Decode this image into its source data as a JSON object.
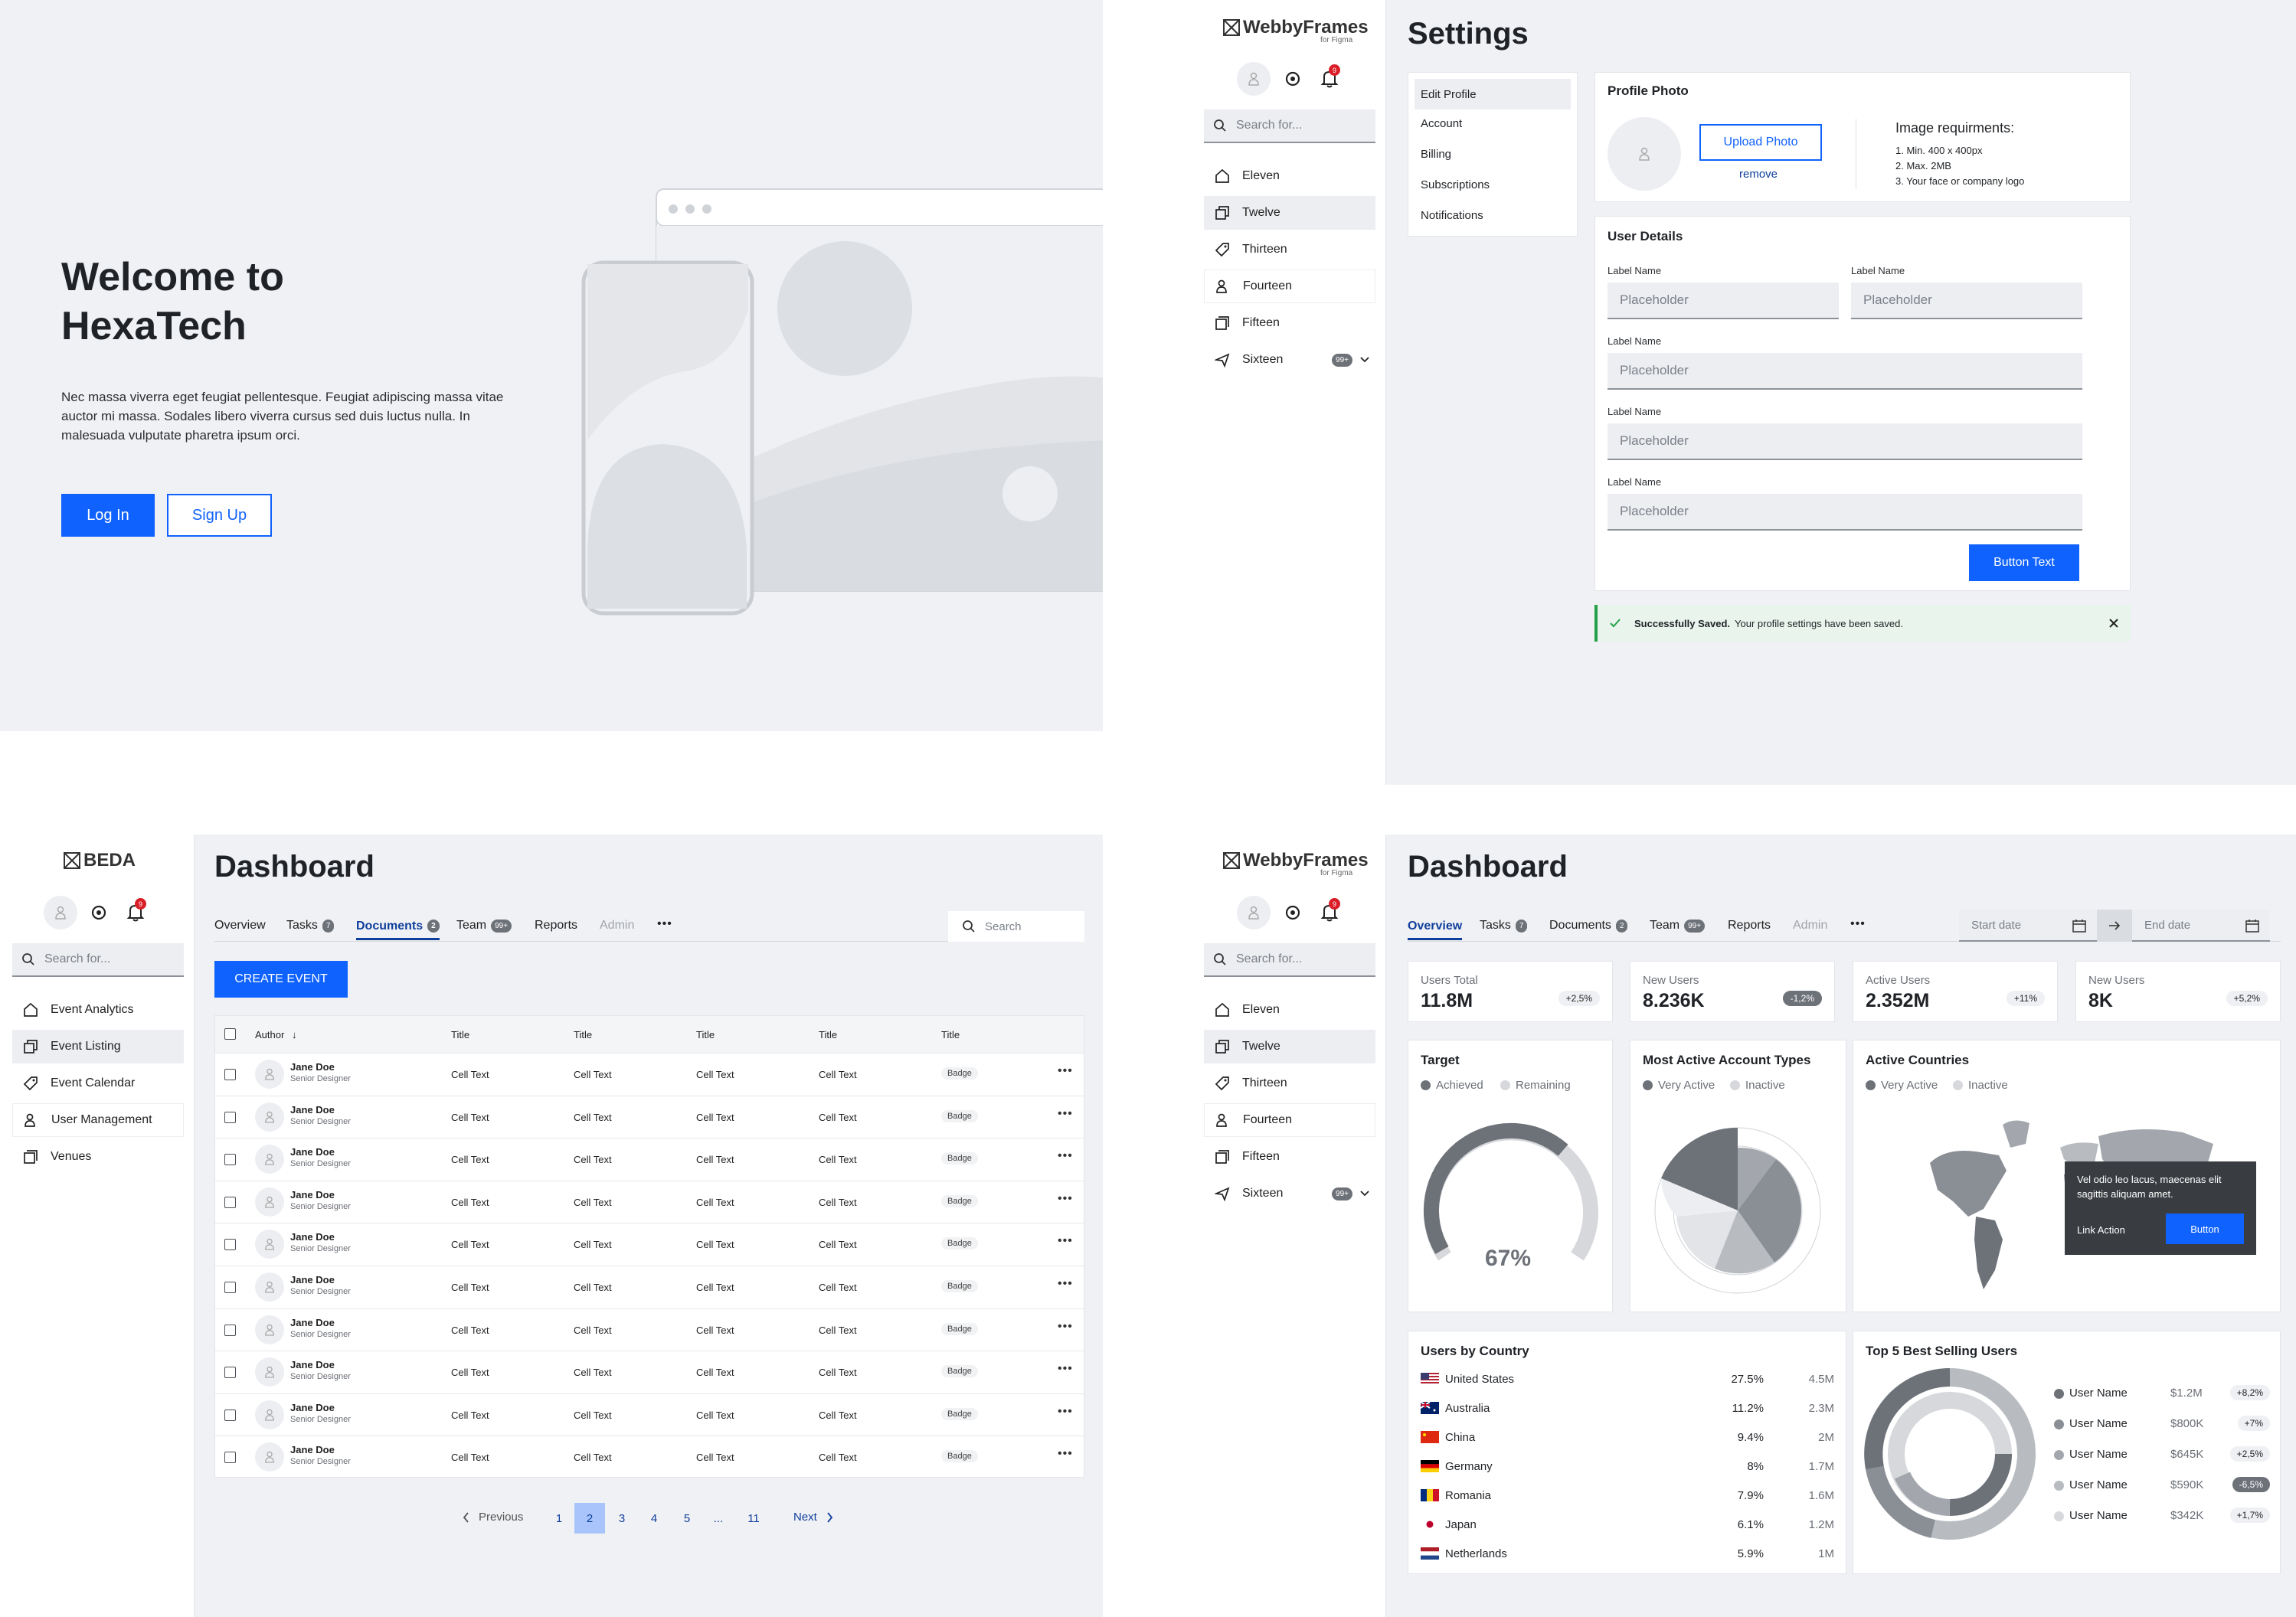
{
  "welcome": {
    "title_line1": "Welcome to",
    "title_line2": "HexaTech",
    "body": "Nec massa viverra eget feugiat pellentesque. Feugiat adipiscing massa vitae auctor mi massa. Sodales libero viverra cursus sed duis luctus nulla. In malesuada vulputate pharetra ipsum orci.",
    "login": "Log In",
    "signup": "Sign Up"
  },
  "brand": {
    "name": "WebbyFrames",
    "sub": "for Figma",
    "beda": "BEDA",
    "notif_count": "9",
    "accent": "#0f62fe"
  },
  "search": {
    "placeholder": "Search for..."
  },
  "nav": {
    "items": [
      {
        "label": "Eleven",
        "icon": "home-icon"
      },
      {
        "label": "Twelve",
        "icon": "copy-icon"
      },
      {
        "label": "Thirteen",
        "icon": "tag-icon"
      },
      {
        "label": "Fourteen",
        "icon": "users-icon"
      },
      {
        "label": "Fifteen",
        "icon": "gallery-icon"
      },
      {
        "label": "Sixteen",
        "icon": "plane-icon",
        "badge": "99+"
      }
    ]
  },
  "beda_nav": {
    "items": [
      "Event Analytics",
      "Event Listing",
      "Event Calendar",
      "User Management",
      "Venues"
    ]
  },
  "settings": {
    "title": "Settings",
    "menu": [
      "Edit Profile",
      "Account",
      "Billing",
      "Subscriptions",
      "Notifications"
    ],
    "photo": {
      "title": "Profile Photo",
      "upload": "Upload Photo",
      "remove": "remove",
      "req_title": "Image requirments:",
      "reqs": [
        "Min.  400 x 400px",
        "Max. 2MB",
        "Your face or company logo"
      ]
    },
    "details": {
      "title": "User Details",
      "label": "Label Name",
      "placeholder": "Placeholder",
      "button": "Button Text"
    },
    "toast": {
      "bold": "Successfully Saved.",
      "text": "Your profile settings have been saved."
    }
  },
  "dash1": {
    "title": "Dashboard",
    "tabs": [
      "Overview",
      "Tasks",
      "Documents",
      "Team",
      "Reports",
      "Admin"
    ],
    "tab_badges": {
      "tasks": "7",
      "documents": "2",
      "team": "99+"
    },
    "search": "Search",
    "create": "CREATE EVENT",
    "cols": [
      "Author",
      "Title",
      "Title",
      "Title",
      "Title",
      "Title"
    ],
    "rows": [
      {
        "name": "Jane Doe",
        "role": "Senior Designer",
        "cell": "Cell Text",
        "badge": "Badge"
      }
    ],
    "pager": {
      "prev": "Previous",
      "pages": [
        "1",
        "2",
        "3",
        "4",
        "5",
        "...",
        "11"
      ],
      "next": "Next",
      "current": "2"
    }
  },
  "dash2": {
    "title": "Dashboard",
    "tabs": [
      "Overview",
      "Tasks",
      "Documents",
      "Team",
      "Reports",
      "Admin"
    ],
    "start": "Start date",
    "end": "End date",
    "stats": [
      {
        "label": "Users Total",
        "value": "11.8M",
        "delta": "+2,5%"
      },
      {
        "label": "New Users",
        "value": "8.236K",
        "delta": "-1,2%"
      },
      {
        "label": "Active Users",
        "value": "2.352M",
        "delta": "+11%"
      },
      {
        "label": "New Users",
        "value": "8K",
        "delta": "+5,2%"
      }
    ],
    "target": {
      "title": "Target",
      "l1": "Achieved",
      "l2": "Remaining",
      "value": "67%",
      "fraction": 0.67
    },
    "types": {
      "title": "Most Active Account Types",
      "l1": "Very Active",
      "l2": "Inactive"
    },
    "countries_map": {
      "title": "Active Countries",
      "l1": "Very Active",
      "l2": "Inactive",
      "tooltip": "Vel odio leo lacus, maecenas elit sagittis aliquam amet.",
      "link": "Link Action",
      "button": "Button"
    },
    "by_country": {
      "title": "Users by Country",
      "rows": [
        {
          "name": "United States",
          "pct": "27.5%",
          "n": "4.5M"
        },
        {
          "name": "Australia",
          "pct": "11.2%",
          "n": "2.3M"
        },
        {
          "name": "China",
          "pct": "9.4%",
          "n": "2M"
        },
        {
          "name": "Germany",
          "pct": "8%",
          "n": "1.7M"
        },
        {
          "name": "Romania",
          "pct": "7.9%",
          "n": "1.6M"
        },
        {
          "name": "Japan",
          "pct": "6.1%",
          "n": "1.2M"
        },
        {
          "name": "Netherlands",
          "pct": "5.9%",
          "n": "1M"
        }
      ]
    },
    "top5": {
      "title": "Top 5 Best Selling Users",
      "rows": [
        {
          "name": "User Name",
          "amt": "$1.2M",
          "d": "+8,2%"
        },
        {
          "name": "User Name",
          "amt": "$800K",
          "d": "+7%"
        },
        {
          "name": "User Name",
          "amt": "$645K",
          "d": "+2,5%"
        },
        {
          "name": "User Name",
          "amt": "$590K",
          "d": "-6,5%"
        },
        {
          "name": "User Name",
          "amt": "$342K",
          "d": "+1,7%"
        }
      ]
    }
  }
}
